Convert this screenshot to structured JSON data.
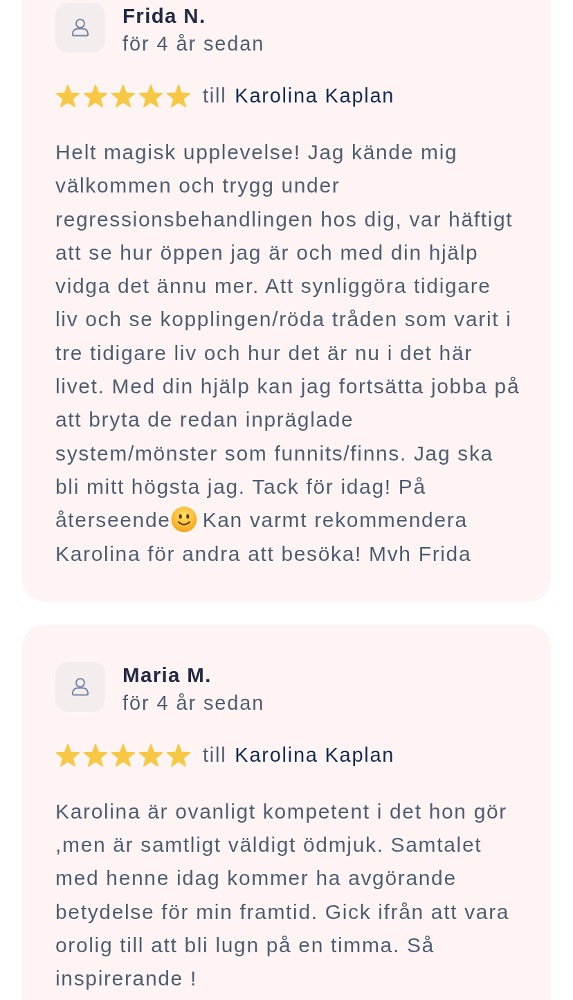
{
  "reviews": [
    {
      "author": "Frida N.",
      "time": "för 4 år sedan",
      "stars": 5,
      "prefix": "till",
      "recipient": "Karolina Kaplan",
      "body": [
        {
          "kind": "text",
          "text": "Helt magisk upplevelse! Jag kände mig välkommen och trygg under regressionsbehandlingen hos dig, var häftigt att se hur öppen jag är och med din hjälp vidga det ännu mer. Att synliggöra tidigare liv och se kopplingen/röda tråden som varit i tre tidigare liv och hur det är nu i det här livet. Med din hjälp kan jag fortsätta jobba på att bryta de redan inpräglade system/mönster som funnits/finns. Jag ska bli mitt högsta jag. Tack för idag! På återseende"
        },
        {
          "kind": "smiley"
        },
        {
          "kind": "text",
          "text": "Kan varmt rekommendera Karolina för andra att besöka! Mvh Frida"
        }
      ]
    },
    {
      "author": "Maria M.",
      "time": "för 4 år sedan",
      "stars": 5,
      "prefix": "till",
      "recipient": "Karolina Kaplan",
      "body": [
        {
          "kind": "text",
          "text": "Karolina är ovanligt kompetent i det hon gör ,men är samtligt väldigt ödmjuk. Samtalet med henne idag kommer ha avgörande betydelse för min framtid. Gick ifrån att vara orolig till att bli lugn på en timma. Så inspirerande !"
        }
      ]
    }
  ]
}
